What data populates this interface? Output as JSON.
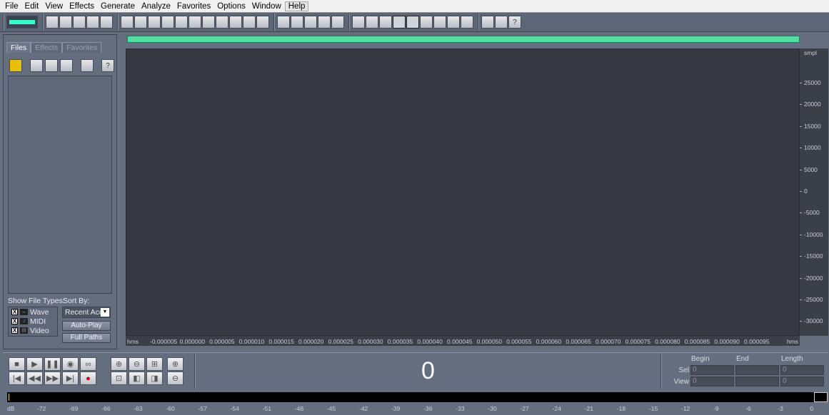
{
  "menu": [
    "File",
    "Edit",
    "View",
    "Effects",
    "Generate",
    "Analyze",
    "Favorites",
    "Options",
    "Window",
    "Help"
  ],
  "toolbar_groups": [
    [
      "mode-toggle-icon"
    ],
    [
      "new-file-icon",
      "open-file-icon",
      "save-icon",
      "save-as-icon",
      "save-all-icon"
    ],
    [
      "undo-icon",
      "redo-icon",
      "repeat-icon",
      "copy-new-icon",
      "copy-icon",
      "cut-icon",
      "paste-icon",
      "paste-new-icon",
      "mix-paste-icon",
      "trim-icon",
      "convert-icon"
    ],
    [
      "spectral-view-icon",
      "loop-icon",
      "grid1-icon",
      "grid2-icon",
      "grid3-icon"
    ],
    [
      "view1-icon",
      "view2-icon",
      "view3-icon",
      "play-cursor-icon",
      "zoom-icon",
      "time-icon",
      "info-icon",
      "level-icon",
      "blank-icon"
    ],
    [
      "settings-icon",
      "script-icon",
      "help-icon"
    ]
  ],
  "left_panel": {
    "tabs": [
      "Files",
      "Effects",
      "Favorites"
    ],
    "file_tools": [
      "open-icon",
      "import-icon",
      "close-icon",
      "insert-icon",
      "settings-icon",
      "help-icon"
    ],
    "show_file_types_label": "Show File Types:",
    "sort_by_label": "Sort By:",
    "file_types": [
      {
        "label": "Wave",
        "checked": true,
        "icon": "wave-icon"
      },
      {
        "label": "MIDI",
        "checked": true,
        "icon": "midi-icon"
      },
      {
        "label": "Video",
        "checked": true,
        "icon": "video-icon"
      }
    ],
    "sort_value": "Recent Acc",
    "auto_play": "Auto-Play",
    "full_paths": "Full Paths"
  },
  "waveform": {
    "y_unit": "smpl",
    "y_labels": [
      "25000",
      "20000",
      "15000",
      "10000",
      "5000",
      "0",
      "-5000",
      "-10000",
      "-15000",
      "-20000",
      "-25000",
      "-30000"
    ],
    "x_unit": "hms",
    "x_labels": [
      "-0.000005",
      "0.000000",
      "0.000005",
      "0.000010",
      "0.000015",
      "0.000020",
      "0.000025",
      "0.000030",
      "0.000035",
      "0.000040",
      "0.000045",
      "0.000050",
      "0.000055",
      "0.000060",
      "0.000065",
      "0.000070",
      "0.000075",
      "0.000080",
      "0.000085",
      "0.000090",
      "0.000095"
    ],
    "overview_color": "#4ee0a0"
  },
  "transport": {
    "buttons": [
      [
        "stop-icon",
        "■"
      ],
      [
        "play-icon",
        "▶"
      ],
      [
        "pause-icon",
        "❚❚"
      ],
      [
        "play-from-cursor-icon",
        "◉"
      ],
      [
        "loop-icon",
        "∞"
      ],
      [
        "go-start-icon",
        "|◀"
      ],
      [
        "rewind-icon",
        "◀◀"
      ],
      [
        "fast-forward-icon",
        "▶▶"
      ],
      [
        "go-end-icon",
        "▶|"
      ],
      [
        "record-icon",
        "●"
      ]
    ],
    "zoom_buttons": [
      [
        "zoom-in-icon",
        "⊕"
      ],
      [
        "zoom-out-icon",
        "⊖"
      ],
      [
        "zoom-full-icon",
        "⊞"
      ],
      [
        "zoom-selection-icon",
        "⊡"
      ],
      [
        "zoom-left-icon",
        "◧"
      ],
      [
        "zoom-right-icon",
        "◨"
      ]
    ],
    "vzoom_buttons": [
      [
        "vertical-zoom-in-icon",
        "⊕"
      ],
      [
        "vertical-zoom-out-icon",
        "⊖"
      ]
    ],
    "time": "0"
  },
  "selection": {
    "headers": [
      "Begin",
      "End",
      "Length"
    ],
    "rows": [
      {
        "label": "Sel",
        "values": [
          "0",
          "",
          "0"
        ]
      },
      {
        "label": "View",
        "values": [
          "0",
          "",
          "0"
        ]
      }
    ]
  },
  "meter": {
    "labels": [
      "dB",
      "-72",
      "-69",
      "-66",
      "-63",
      "-60",
      "-57",
      "-54",
      "-51",
      "-48",
      "-45",
      "-42",
      "-39",
      "-36",
      "-33",
      "-30",
      "-27",
      "-24",
      "-21",
      "-18",
      "-15",
      "-12",
      "-9",
      "-6",
      "-3",
      "0"
    ]
  }
}
